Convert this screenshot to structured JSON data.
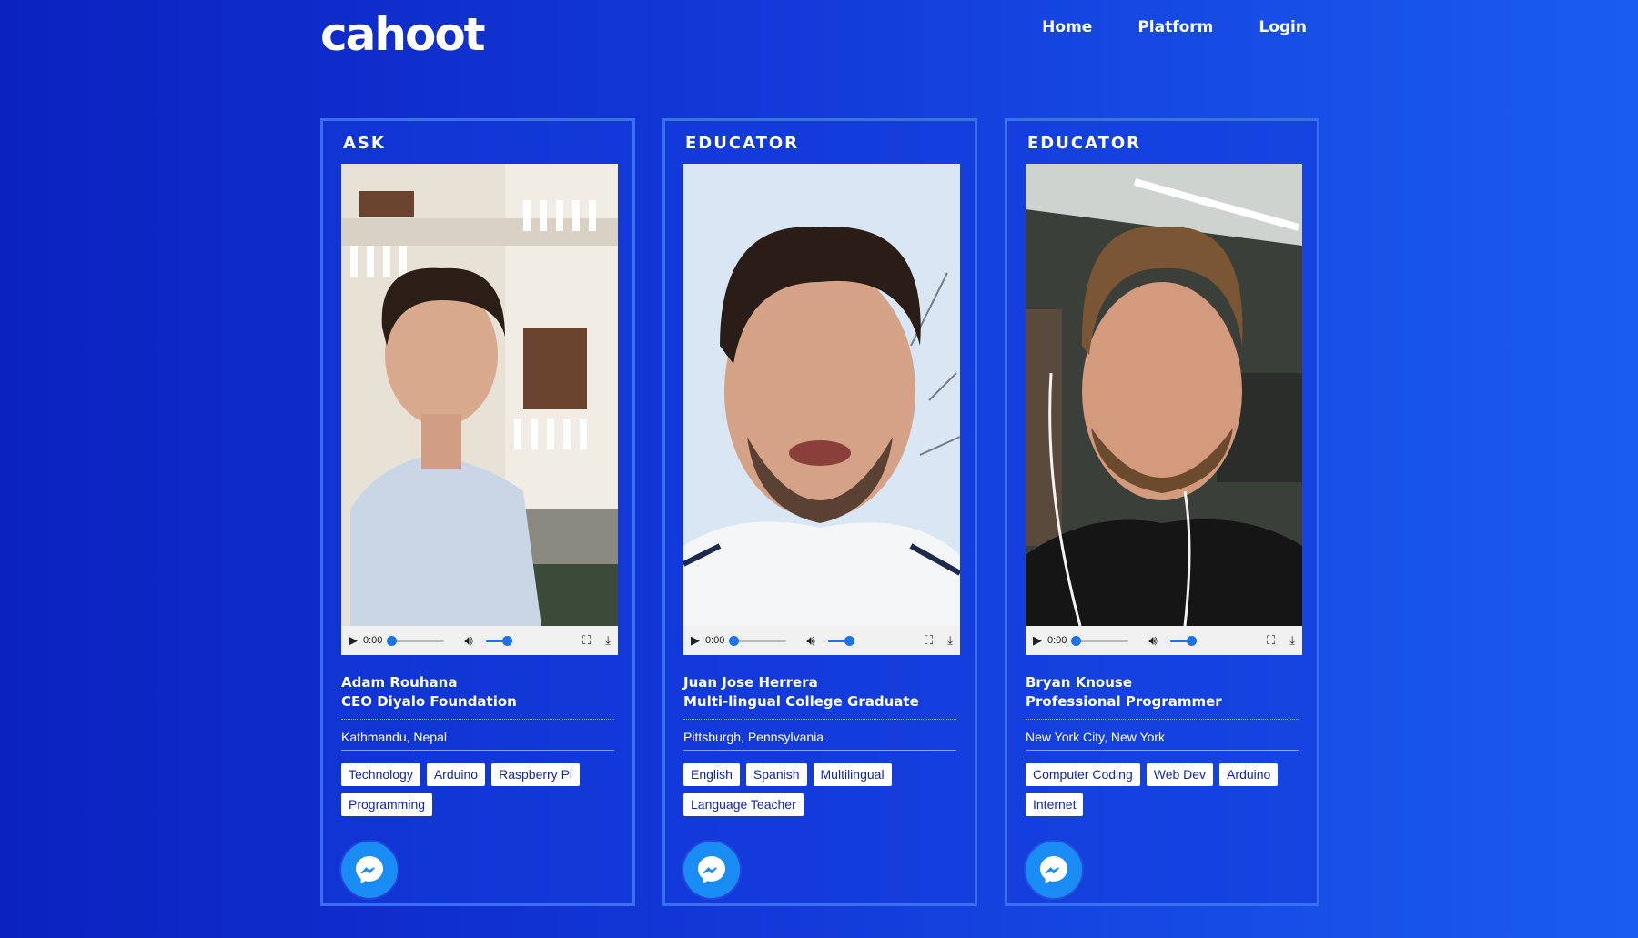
{
  "header": {
    "logo": "cahoot",
    "nav": [
      "Home",
      "Platform",
      "Login"
    ]
  },
  "colors": {
    "accent": "#1a8cf5",
    "background": "#1238d8",
    "tag_text": "#1027b0"
  },
  "video_controls": {
    "time": "0:00",
    "icons": [
      "play-icon",
      "volume-icon",
      "fullscreen-icon",
      "download-icon"
    ]
  },
  "cards": [
    {
      "role": "ASK",
      "name": "Adam Rouhana",
      "title": "CEO Diyalo Foundation",
      "location": "Kathmandu, Nepal",
      "tags": [
        "Technology",
        "Arduino",
        "Raspberry Pi",
        "Programming"
      ]
    },
    {
      "role": "EDUCATOR",
      "name": "Juan Jose Herrera",
      "title": "Multi-lingual College Graduate",
      "location": "Pittsburgh, Pennsylvania",
      "tags": [
        "English",
        "Spanish",
        "Multilingual",
        "Language Teacher"
      ]
    },
    {
      "role": "EDUCATOR",
      "name": "Bryan Knouse",
      "title": "Professional Programmer",
      "location": "New York City, New York",
      "tags": [
        "Computer Coding",
        "Web Dev",
        "Arduino",
        "Internet"
      ]
    }
  ]
}
